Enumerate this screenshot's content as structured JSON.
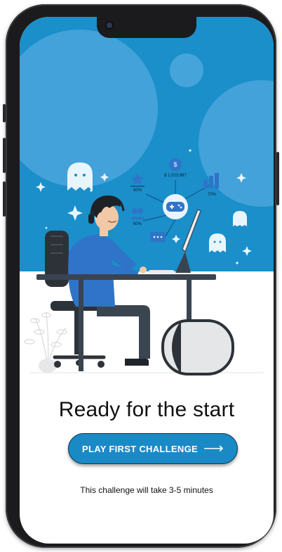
{
  "illustration": {
    "balance": "$ 1,023,987",
    "stat_left": "80%",
    "stat_right": "70%",
    "stat_bottom": "60%"
  },
  "main": {
    "title": "Ready for the start",
    "cta_label": "PLAY FIRST CHALLENGE",
    "cta_icon": "arrow-right-icon",
    "note": "This challenge will take 3-5 minutes"
  },
  "colors": {
    "accent": "#1a8ac7",
    "sky": "#1a8fca"
  }
}
